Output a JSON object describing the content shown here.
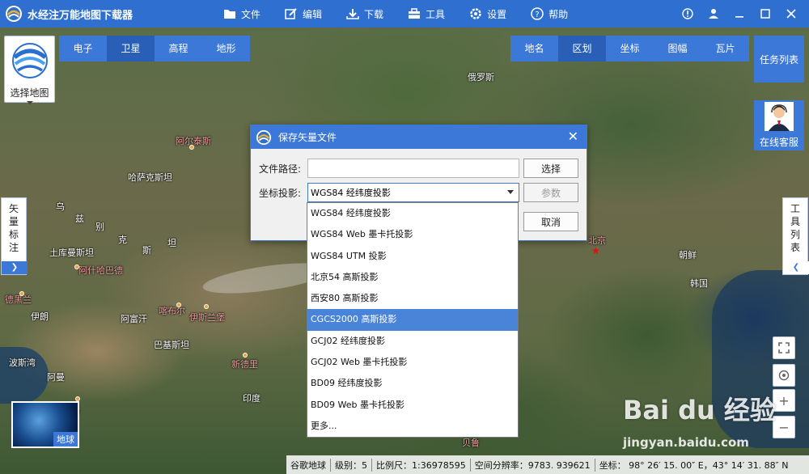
{
  "app": {
    "title": "水经注万能地图下载器"
  },
  "menu": [
    {
      "label": "文件",
      "icon": "folder-icon"
    },
    {
      "label": "编辑",
      "icon": "edit-icon"
    },
    {
      "label": "下载",
      "icon": "download-icon"
    },
    {
      "label": "工具",
      "icon": "toolbox-icon"
    },
    {
      "label": "设置",
      "icon": "gear-icon"
    },
    {
      "label": "帮助",
      "icon": "help-icon"
    }
  ],
  "select_map": {
    "label": "选择地图"
  },
  "map_types": {
    "items": [
      "电子",
      "卫星",
      "高程",
      "地形"
    ],
    "active": "卫星"
  },
  "layers": {
    "items": [
      "地名",
      "区划",
      "坐标",
      "图幅",
      "瓦片"
    ],
    "active": "区划"
  },
  "task_list": {
    "label": "任务列表"
  },
  "online_service": {
    "label": "在线客服"
  },
  "vector_annot": {
    "label": "矢\n量\n标\n注"
  },
  "tool_list": {
    "label": "工\n具\n列\n表"
  },
  "map_labels": [
    {
      "text": "俄罗斯",
      "pink": false
    },
    {
      "text": "阿尔泰斯",
      "pink": true
    },
    {
      "text": "哈萨克斯坦",
      "pink": false
    },
    {
      "text": "乌",
      "pink": false
    },
    {
      "text": "兹",
      "pink": false
    },
    {
      "text": "别",
      "pink": false
    },
    {
      "text": "克",
      "pink": false
    },
    {
      "text": "斯",
      "pink": false
    },
    {
      "text": "坦",
      "pink": false
    },
    {
      "text": "土库曼斯坦",
      "pink": false
    },
    {
      "text": "阿什哈巴德",
      "pink": true
    },
    {
      "text": "德黑兰",
      "pink": true
    },
    {
      "text": "伊朗",
      "pink": false
    },
    {
      "text": "阿富汗",
      "pink": false
    },
    {
      "text": "喀布尔",
      "pink": true
    },
    {
      "text": "伊斯兰堡",
      "pink": true
    },
    {
      "text": "巴基斯坦",
      "pink": false
    },
    {
      "text": "新德里",
      "pink": true
    },
    {
      "text": "波斯湾",
      "pink": false
    },
    {
      "text": "阿曼",
      "pink": false
    },
    {
      "text": "印度",
      "pink": false
    },
    {
      "text": "北京",
      "pink": true
    },
    {
      "text": "朝鲜",
      "pink": false
    },
    {
      "text": "韩国",
      "pink": false
    },
    {
      "text": "马斯",
      "pink": true
    },
    {
      "text": "贝鲁",
      "pink": true
    }
  ],
  "earth_thumb": {
    "label": "地球"
  },
  "status": {
    "source": "谷歌地球",
    "level": "级别：5",
    "scale": "比例尺：1:36978595",
    "resolution": "空间分辨率：9783. 939621",
    "coords": "坐标： 98° 26′ 15. 00″ E，43° 14′ 31. 88″ N"
  },
  "watermark": {
    "brand": "Bai du 经验",
    "url": "jingyan.baidu.com"
  },
  "dialog": {
    "title": "保存矢量文件",
    "path_label": "文件路径:",
    "path_value": "",
    "select_btn": "选择",
    "proj_label": "坐标投影:",
    "proj_value": "WGS84 经纬度投影",
    "params_btn": "参数",
    "cancel_btn": "取消",
    "options": [
      "WGS84 经纬度投影",
      "WGS84 Web 墨卡托投影",
      "WGS84 UTM 投影",
      "北京54 高斯投影",
      "西安80 高斯投影",
      "CGCS2000 高斯投影",
      "GCJ02 经纬度投影",
      "GCJ02 Web 墨卡托投影",
      "BD09 经纬度投影",
      "BD09 Web 墨卡托投影",
      "更多..."
    ],
    "highlighted": "CGCS2000 高斯投影"
  },
  "colors": {
    "primary": "#3b78d8",
    "titlebar": "#2e6fcf",
    "selected": "#4a84d8"
  }
}
